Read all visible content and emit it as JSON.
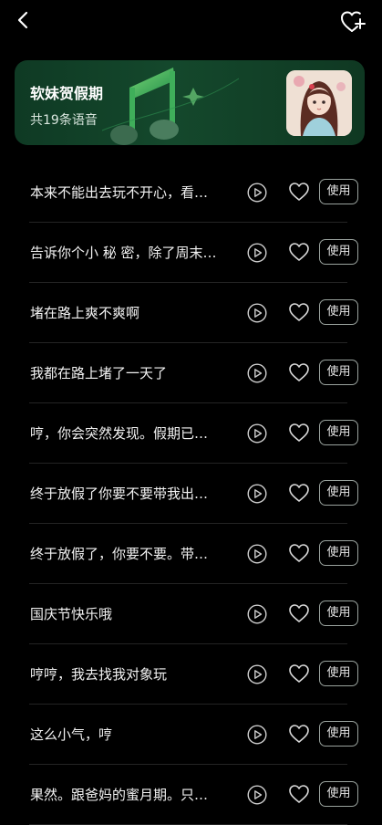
{
  "banner": {
    "title": "软妹贺假期",
    "subtitle": "共19条语音"
  },
  "icons": {
    "back": "back-arrow-icon",
    "favorite": "heart-plus-icon",
    "play": "play-circle-icon",
    "like": "heart-outline-icon",
    "art": "music-note-icon"
  },
  "colors": {
    "background": "#000000",
    "banner_green": "#14482c",
    "accent": "#3bbf6a"
  },
  "list": {
    "items": [
      {
        "text": "本来不能出去玩不开心，看…",
        "action": "使用"
      },
      {
        "text": "告诉你个小 秘 密，除了周末…",
        "action": "使用"
      },
      {
        "text": "堵在路上爽不爽啊",
        "action": "使用"
      },
      {
        "text": "我都在路上堵了一天了",
        "action": "使用"
      },
      {
        "text": "哼，你会突然发现。假期已…",
        "action": "使用"
      },
      {
        "text": "终于放假了你要不要带我出…",
        "action": "使用"
      },
      {
        "text": "终于放假了，你要不要。带…",
        "action": "使用"
      },
      {
        "text": "国庆节快乐哦",
        "action": "使用"
      },
      {
        "text": "哼哼，我去找我对象玩",
        "action": "使用"
      },
      {
        "text": "这么小气，哼",
        "action": "使用"
      },
      {
        "text": "果然。跟爸妈的蜜月期。只…",
        "action": "使用"
      }
    ]
  }
}
